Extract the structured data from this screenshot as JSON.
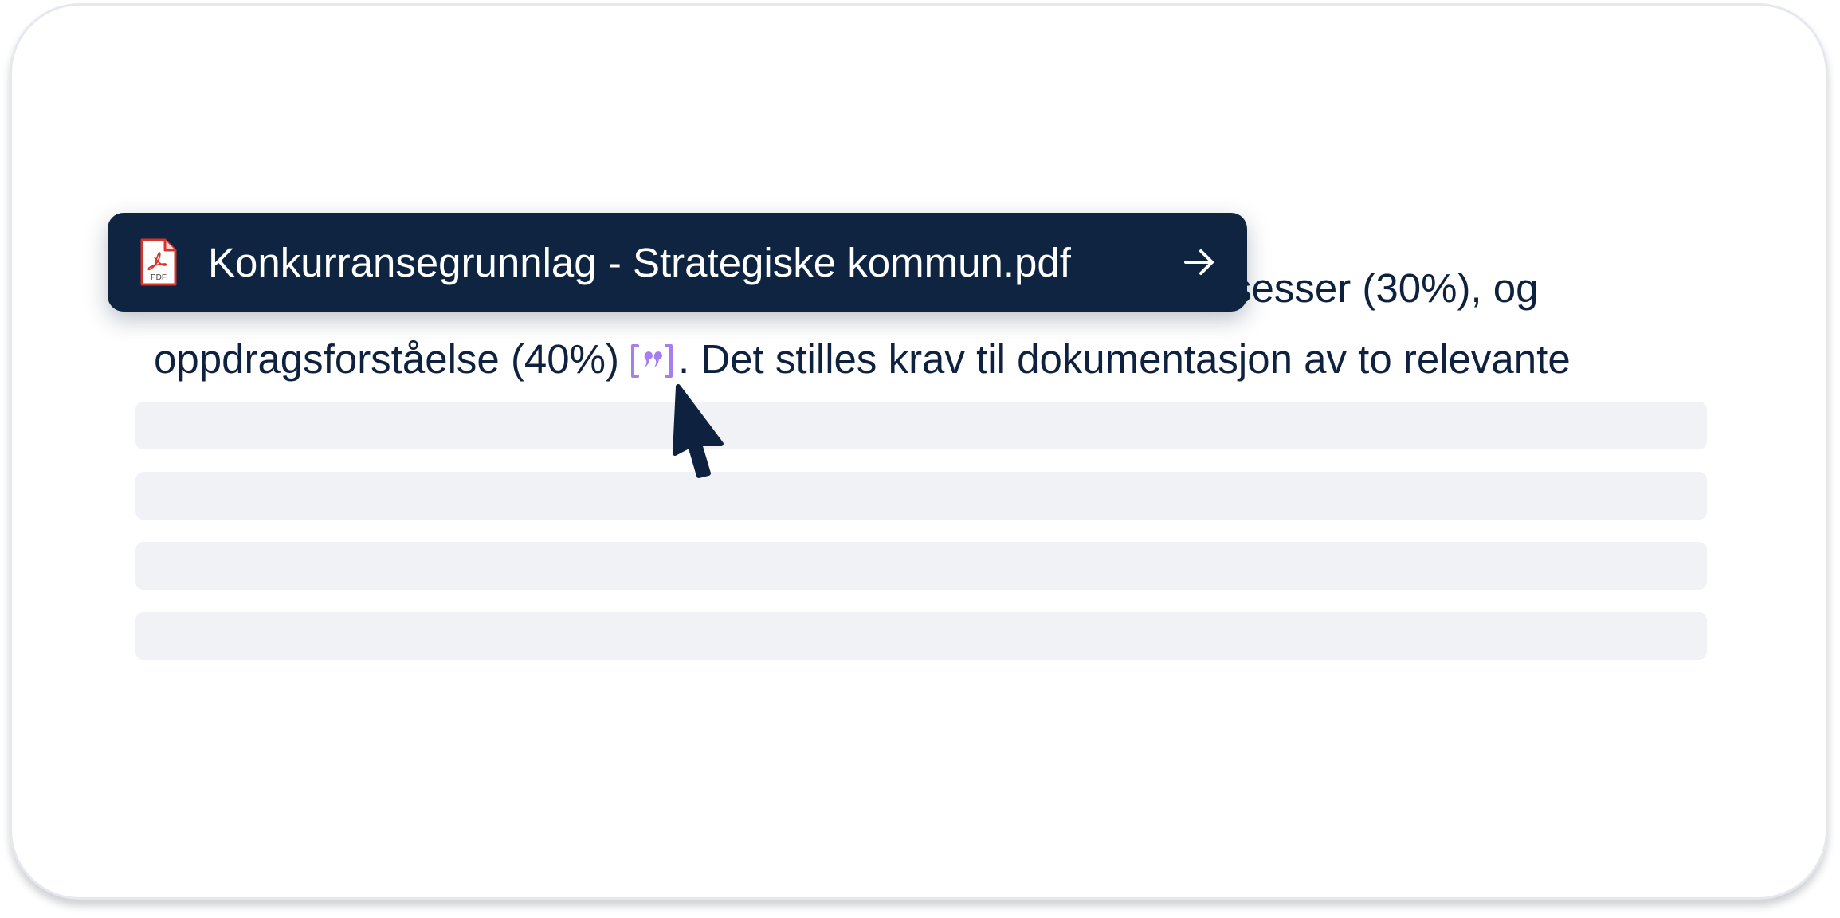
{
  "document": {
    "line1_visible_tail": "sesser (30%), og",
    "line2_before_citation": "oppdragsforståelse (40%)",
    "line2_after_citation": ". Det stilles krav til dokumentasjon av to relevante"
  },
  "citation_popover": {
    "file_name": "Konkurransegrunnlag - Strategiske kommun.pdf",
    "file_type_label": "PDF",
    "icon": "pdf-file-icon",
    "action_icon": "arrow-right-icon"
  },
  "citation_marker": {
    "icon": "quote-citation-icon",
    "color": "#a67ef0"
  },
  "colors": {
    "text": "#0e223f",
    "popover_background": "#0e2440",
    "placeholder": "#f1f2f5",
    "pdf_red": "#d9342b"
  }
}
